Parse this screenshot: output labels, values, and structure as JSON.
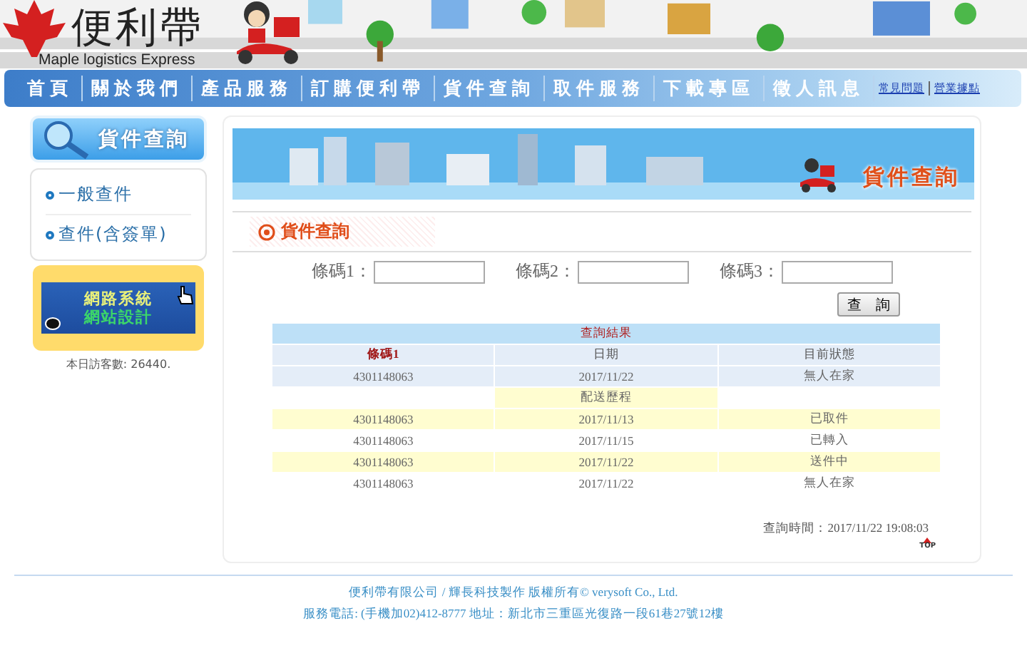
{
  "header": {
    "logo_title": "便利帶",
    "logo_subtitle": "Maple logistics Express"
  },
  "nav": {
    "items": [
      "首頁",
      "關於我們",
      "產品服務",
      "訂購便利帶",
      "貨件查詢",
      "取件服務",
      "下載專區",
      "徵人訊息"
    ],
    "links": [
      "常見問題",
      "營業據點"
    ]
  },
  "sidebar": {
    "banner": "貨件查詢",
    "menu": [
      "一般查件",
      "查件(含簽單)"
    ],
    "ad": [
      "網路系統",
      "網站設計"
    ],
    "visitors": "本日訪客數: 26440."
  },
  "main": {
    "banner_title": "貨件查詢",
    "section_title": "貨件查詢",
    "fields": [
      {
        "label": "條碼1："
      },
      {
        "label": "條碼2："
      },
      {
        "label": "條碼3："
      }
    ],
    "search_button": "查　詢",
    "results": {
      "title": "查詢結果",
      "columns": [
        "條碼1",
        "日期",
        "目前狀態"
      ],
      "current": [
        "4301148063",
        "2017/11/22",
        "無人在家"
      ],
      "history_title": "配送歷程",
      "history": [
        [
          "4301148063",
          "2017/11/13",
          "已取件"
        ],
        [
          "4301148063",
          "2017/11/15",
          "已轉入"
        ],
        [
          "4301148063",
          "2017/11/22",
          "送件中"
        ],
        [
          "4301148063",
          "2017/11/22",
          "無人在家"
        ]
      ]
    },
    "query_time": "查詢時間：2017/11/22 19:08:03",
    "top": "TOP"
  },
  "footer": [
    "便利帶有限公司 / 輝長科技製作 版權所有© verysoft Co., Ltd.",
    "服務電話: (手機加02)412-8777 地址：新北市三重區光復路一段61巷27號12樓"
  ]
}
